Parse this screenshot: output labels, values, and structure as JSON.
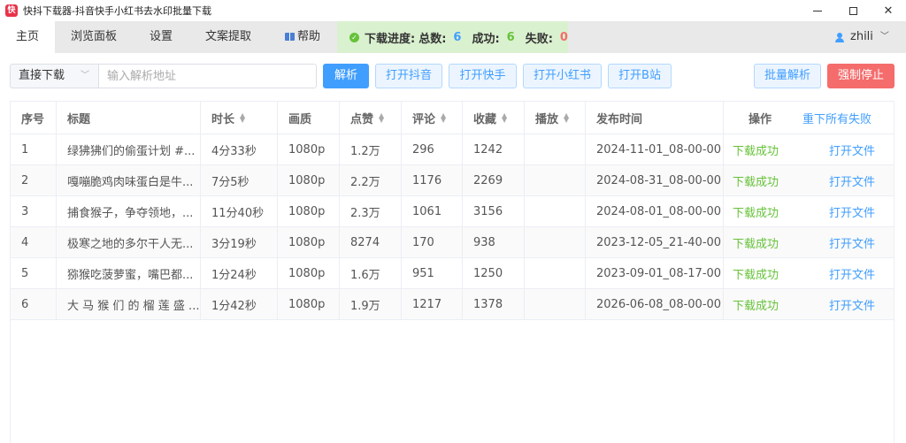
{
  "window": {
    "icon_text": "快",
    "title": "快抖下载器-抖音快手小红书去水印批量下载"
  },
  "tabs": [
    {
      "label": "主页",
      "active": true
    },
    {
      "label": "浏览面板",
      "active": false
    },
    {
      "label": "设置",
      "active": false
    },
    {
      "label": "文案提取",
      "active": false
    },
    {
      "label": "帮助",
      "active": false
    }
  ],
  "progress": {
    "label": "下载进度:",
    "total_label": "总数:",
    "total": "6",
    "success_label": "成功:",
    "success": "6",
    "fail_label": "失败:",
    "fail": "0"
  },
  "user": {
    "name": "zhili"
  },
  "toolbar": {
    "mode_selected": "直接下载",
    "url_placeholder": "输入解析地址",
    "parse": "解析",
    "open_douyin": "打开抖音",
    "open_kuaishou": "打开快手",
    "open_xiaohongshu": "打开小红书",
    "open_bilibili": "打开B站",
    "batch_parse": "批量解析",
    "force_stop": "强制停止"
  },
  "table": {
    "headers": {
      "index": "序号",
      "title": "标题",
      "duration": "时长",
      "quality": "画质",
      "likes": "点赞",
      "comments": "评论",
      "favorites": "收藏",
      "plays": "播放",
      "publish_time": "发布时间",
      "actions": "操作",
      "redownload_all": "重下所有失败"
    },
    "rows": [
      {
        "index": "1",
        "title": "绿狒狒们的偷蛋计划 #...",
        "duration": "4分33秒",
        "quality": "1080p",
        "likes": "1.2万",
        "comments": "296",
        "favorites": "1242",
        "plays": "",
        "publish_time": "2024-11-01_08-00-00",
        "status": "下载成功",
        "open": "打开文件"
      },
      {
        "index": "2",
        "title": "嘎嘣脆鸡肉味蛋白是牛...",
        "duration": "7分5秒",
        "quality": "1080p",
        "likes": "2.2万",
        "comments": "1176",
        "favorites": "2269",
        "plays": "",
        "publish_time": "2024-08-31_08-00-00",
        "status": "下载成功",
        "open": "打开文件"
      },
      {
        "index": "3",
        "title": "捕食猴子，争夺领地，...",
        "duration": "11分40秒",
        "quality": "1080p",
        "likes": "2.3万",
        "comments": "1061",
        "favorites": "3156",
        "plays": "",
        "publish_time": "2024-08-01_08-00-00",
        "status": "下载成功",
        "open": "打开文件"
      },
      {
        "index": "4",
        "title": "极寒之地的多尔干人无...",
        "duration": "3分19秒",
        "quality": "1080p",
        "likes": "8274",
        "comments": "170",
        "favorites": "938",
        "plays": "",
        "publish_time": "2023-12-05_21-40-00",
        "status": "下载成功",
        "open": "打开文件"
      },
      {
        "index": "5",
        "title": "猕猴吃菠萝蜜，嘴巴都...",
        "duration": "1分24秒",
        "quality": "1080p",
        "likes": "1.6万",
        "comments": "951",
        "favorites": "1250",
        "plays": "",
        "publish_time": "2023-09-01_08-17-00",
        "status": "下载成功",
        "open": "打开文件"
      },
      {
        "index": "6",
        "title": "大 马 猴 们 的 榴 莲 盛 ...",
        "duration": "1分42秒",
        "quality": "1080p",
        "likes": "1.9万",
        "comments": "1217",
        "favorites": "1378",
        "plays": "",
        "publish_time": "2026-06-08_08-00-00",
        "status": "下载成功",
        "open": "打开文件"
      }
    ]
  },
  "colors": {
    "primary": "#409eff",
    "success": "#67c23a",
    "danger": "#f56c6c",
    "progress_bg": "#daf1d0"
  }
}
